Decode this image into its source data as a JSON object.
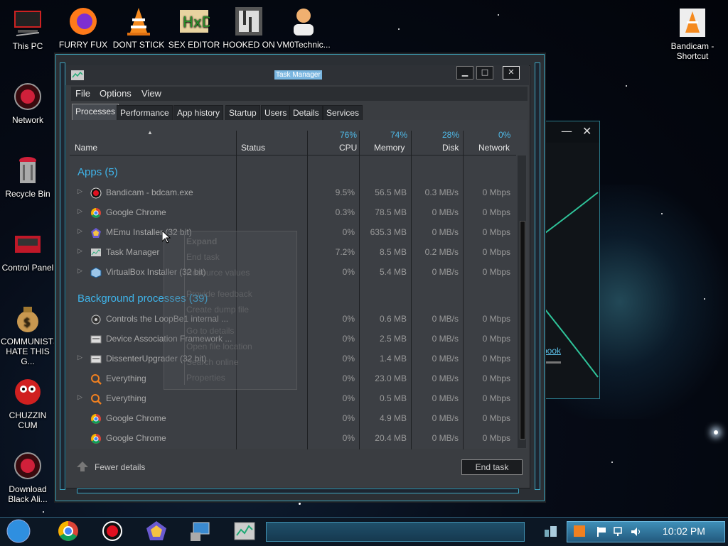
{
  "desktop": {
    "icons": [
      {
        "label": "This PC"
      },
      {
        "label": "FURRY FUX"
      },
      {
        "label": "DONT STICK"
      },
      {
        "label": "SEX EDITOR"
      },
      {
        "label": "HOOKED ON"
      },
      {
        "label": "VM0Technic..."
      },
      {
        "label": "Network"
      },
      {
        "label": "Recycle Bin"
      },
      {
        "label": "Control Panel"
      },
      {
        "label": "COMMUNISTS HATE THIS G..."
      },
      {
        "label": "CHUZZIN CUM"
      },
      {
        "label": "Download Black Ali..."
      },
      {
        "label": "Bandicam - Shortcut"
      }
    ]
  },
  "bg_window": {
    "minimize": "—",
    "close": "✕",
    "link": "pook"
  },
  "task_manager": {
    "title": "Task Manager",
    "menu": [
      "File",
      "Options",
      "View"
    ],
    "tabs": [
      "Processes",
      "Performance",
      "App history",
      "Startup",
      "Users",
      "Details",
      "Services"
    ],
    "columns": {
      "name": "Name",
      "status": "Status",
      "cpu": {
        "pct": "76%",
        "label": "CPU"
      },
      "memory": {
        "pct": "74%",
        "label": "Memory"
      },
      "disk": {
        "pct": "28%",
        "label": "Disk"
      },
      "network": {
        "pct": "0%",
        "label": "Network"
      }
    },
    "groups": {
      "apps": "Apps (5)",
      "background": "Background processes (39)"
    },
    "apps": [
      {
        "name": "Bandicam - bdcam.exe",
        "cpu": "9.5%",
        "memory": "56.5 MB",
        "disk": "0.3 MB/s",
        "network": "0 Mbps",
        "icon": "bandicam-icon",
        "expandable": true
      },
      {
        "name": "Google Chrome",
        "cpu": "0.3%",
        "memory": "78.5 MB",
        "disk": "0 MB/s",
        "network": "0 Mbps",
        "icon": "chrome-icon",
        "expandable": true
      },
      {
        "name": "MEmu Installer (32 bit)",
        "cpu": "0%",
        "memory": "635.3 MB",
        "disk": "0 MB/s",
        "network": "0 Mbps",
        "icon": "memu-icon",
        "expandable": true
      },
      {
        "name": "Task Manager",
        "cpu": "7.2%",
        "memory": "8.5 MB",
        "disk": "0.2 MB/s",
        "network": "0 Mbps",
        "icon": "task-manager-icon",
        "expandable": true
      },
      {
        "name": "VirtualBox Installer (32 bit)",
        "cpu": "0%",
        "memory": "5.4 MB",
        "disk": "0 MB/s",
        "network": "0 Mbps",
        "icon": "virtualbox-icon",
        "expandable": true
      }
    ],
    "background": [
      {
        "name": "Controls the LoopBe1 internal ...",
        "cpu": "0%",
        "memory": "0.6 MB",
        "disk": "0 MB/s",
        "network": "0 Mbps",
        "icon": "loopbe-icon",
        "expandable": false
      },
      {
        "name": "Device Association Framework ...",
        "cpu": "0%",
        "memory": "2.5 MB",
        "disk": "0 MB/s",
        "network": "0 Mbps",
        "icon": "service-icon",
        "expandable": false
      },
      {
        "name": "DissenterUpgrader (32 bit)",
        "cpu": "0%",
        "memory": "1.4 MB",
        "disk": "0 MB/s",
        "network": "0 Mbps",
        "icon": "service-icon",
        "expandable": true
      },
      {
        "name": "Everything",
        "cpu": "0%",
        "memory": "23.0 MB",
        "disk": "0 MB/s",
        "network": "0 Mbps",
        "icon": "everything-icon",
        "expandable": false
      },
      {
        "name": "Everything",
        "cpu": "0%",
        "memory": "0.5 MB",
        "disk": "0 MB/s",
        "network": "0 Mbps",
        "icon": "everything-icon",
        "expandable": true
      },
      {
        "name": "Google Chrome",
        "cpu": "0%",
        "memory": "4.9 MB",
        "disk": "0 MB/s",
        "network": "0 Mbps",
        "icon": "chrome-icon",
        "expandable": false
      },
      {
        "name": "Google Chrome",
        "cpu": "0%",
        "memory": "20.4 MB",
        "disk": "0 MB/s",
        "network": "0 Mbps",
        "icon": "chrome-icon",
        "expandable": false
      }
    ],
    "context_menu": [
      "Expand",
      "End task",
      "Resource values",
      "Provide feedback",
      "Create dump file",
      "Go to details",
      "Open file location",
      "Search online",
      "Properties"
    ],
    "footer": {
      "fewer_details": "Fewer details",
      "end_task": "End task"
    }
  },
  "taskbar": {
    "clock": "10:02 PM"
  },
  "colors": {
    "accent": "#3fb4ea",
    "frame": "#3ea6c2",
    "panel": "#3c3f44"
  }
}
